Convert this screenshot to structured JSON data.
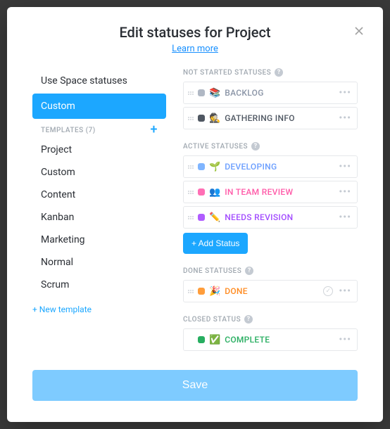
{
  "header": {
    "title": "Edit statuses for Project",
    "learn_more": "Learn more"
  },
  "left": {
    "use_space": "Use Space statuses",
    "custom": "Custom",
    "templates_label": "TEMPLATES (7)",
    "templates": [
      "Project",
      "Custom",
      "Content",
      "Kanban",
      "Marketing",
      "Normal",
      "Scrum"
    ],
    "new_template": "+ New template"
  },
  "groups": {
    "not_started": {
      "label": "NOT STARTED STATUSES",
      "items": [
        {
          "color": "#b0b8c4",
          "emoji": "📚",
          "name": "BACKLOG",
          "text_color": "#8a94a6"
        },
        {
          "color": "#4f5762",
          "emoji": "🕵️",
          "name": "GATHERING INFO",
          "text_color": "#4f5762"
        }
      ]
    },
    "active": {
      "label": "ACTIVE STATUSES",
      "items": [
        {
          "color": "#7fb5ff",
          "emoji": "🌱",
          "name": "DEVELOPING",
          "text_color": "#6a9eff"
        },
        {
          "color": "#ff6fb5",
          "emoji": "👥",
          "name": "IN TEAM REVIEW",
          "text_color": "#ff5aa8"
        },
        {
          "color": "#b05cff",
          "emoji": "✏️",
          "name": "NEEDS REVISION",
          "text_color": "#a24bff"
        }
      ],
      "add_label": "+ Add Status"
    },
    "done": {
      "label": "DONE STATUSES",
      "items": [
        {
          "color": "#ff9d3b",
          "emoji": "🎉",
          "name": "DONE",
          "text_color": "#ff8a1f"
        }
      ]
    },
    "closed": {
      "label": "CLOSED STATUS",
      "items": [
        {
          "color": "#27ae60",
          "emoji": "✅",
          "name": "COMPLETE",
          "text_color": "#27ae60"
        }
      ]
    }
  },
  "footer": {
    "save": "Save"
  }
}
